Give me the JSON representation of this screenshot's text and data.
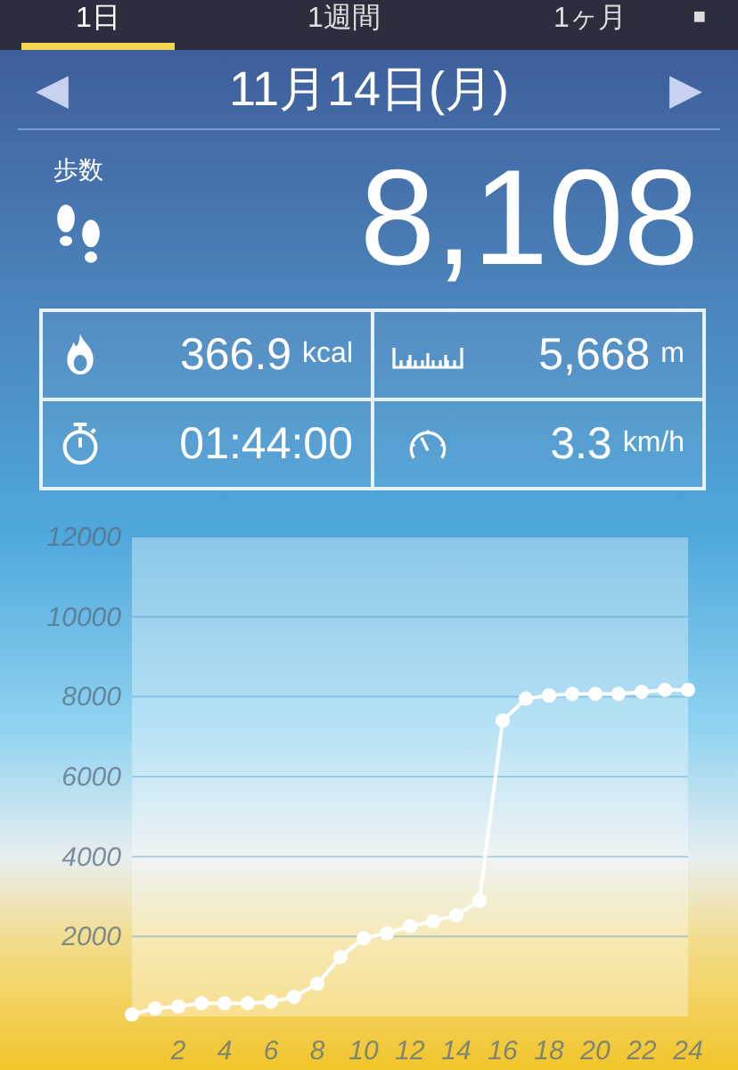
{
  "tabs": [
    {
      "label": "1日",
      "selected": true
    },
    {
      "label": "1週間",
      "selected": false
    },
    {
      "label": "1ヶ月",
      "selected": false
    }
  ],
  "menu_glyph": "■",
  "date": {
    "prev": "◀",
    "label": "11月14日(月)",
    "next": "▶"
  },
  "steps": {
    "label": "歩数",
    "value": "8,108"
  },
  "stats": [
    {
      "kind": "calories",
      "value": "366.9",
      "unit": "kcal"
    },
    {
      "kind": "distance",
      "value": "5,668",
      "unit": "m"
    },
    {
      "kind": "time",
      "value": "01:44:00"
    },
    {
      "kind": "speed",
      "value": "3.3",
      "unit": "km/h"
    }
  ],
  "chart_data": {
    "type": "line",
    "x": [
      0,
      1,
      2,
      3,
      4,
      5,
      6,
      7,
      8,
      9,
      10,
      11,
      12,
      13,
      14,
      15,
      16,
      17,
      18,
      19,
      20,
      21,
      22,
      23,
      24
    ],
    "grid": true,
    "series": [
      {
        "color": "#ffffff",
        "marker": true,
        "values": [
          50,
          200,
          250,
          330,
          330,
          330,
          370,
          490,
          820,
          1490,
          1960,
          2080,
          2260,
          2380,
          2530,
          2900,
          7400,
          7950,
          8030,
          8070,
          8070,
          8070,
          8120,
          8170,
          8170
        ]
      }
    ],
    "xlim": [
      0,
      24
    ],
    "ylim": [
      0,
      12000
    ],
    "xticks": [
      2,
      4,
      6,
      8,
      10,
      12,
      14,
      16,
      18,
      20,
      22,
      24
    ],
    "yticks": [
      2000,
      4000,
      6000,
      8000,
      10000,
      12000
    ]
  }
}
